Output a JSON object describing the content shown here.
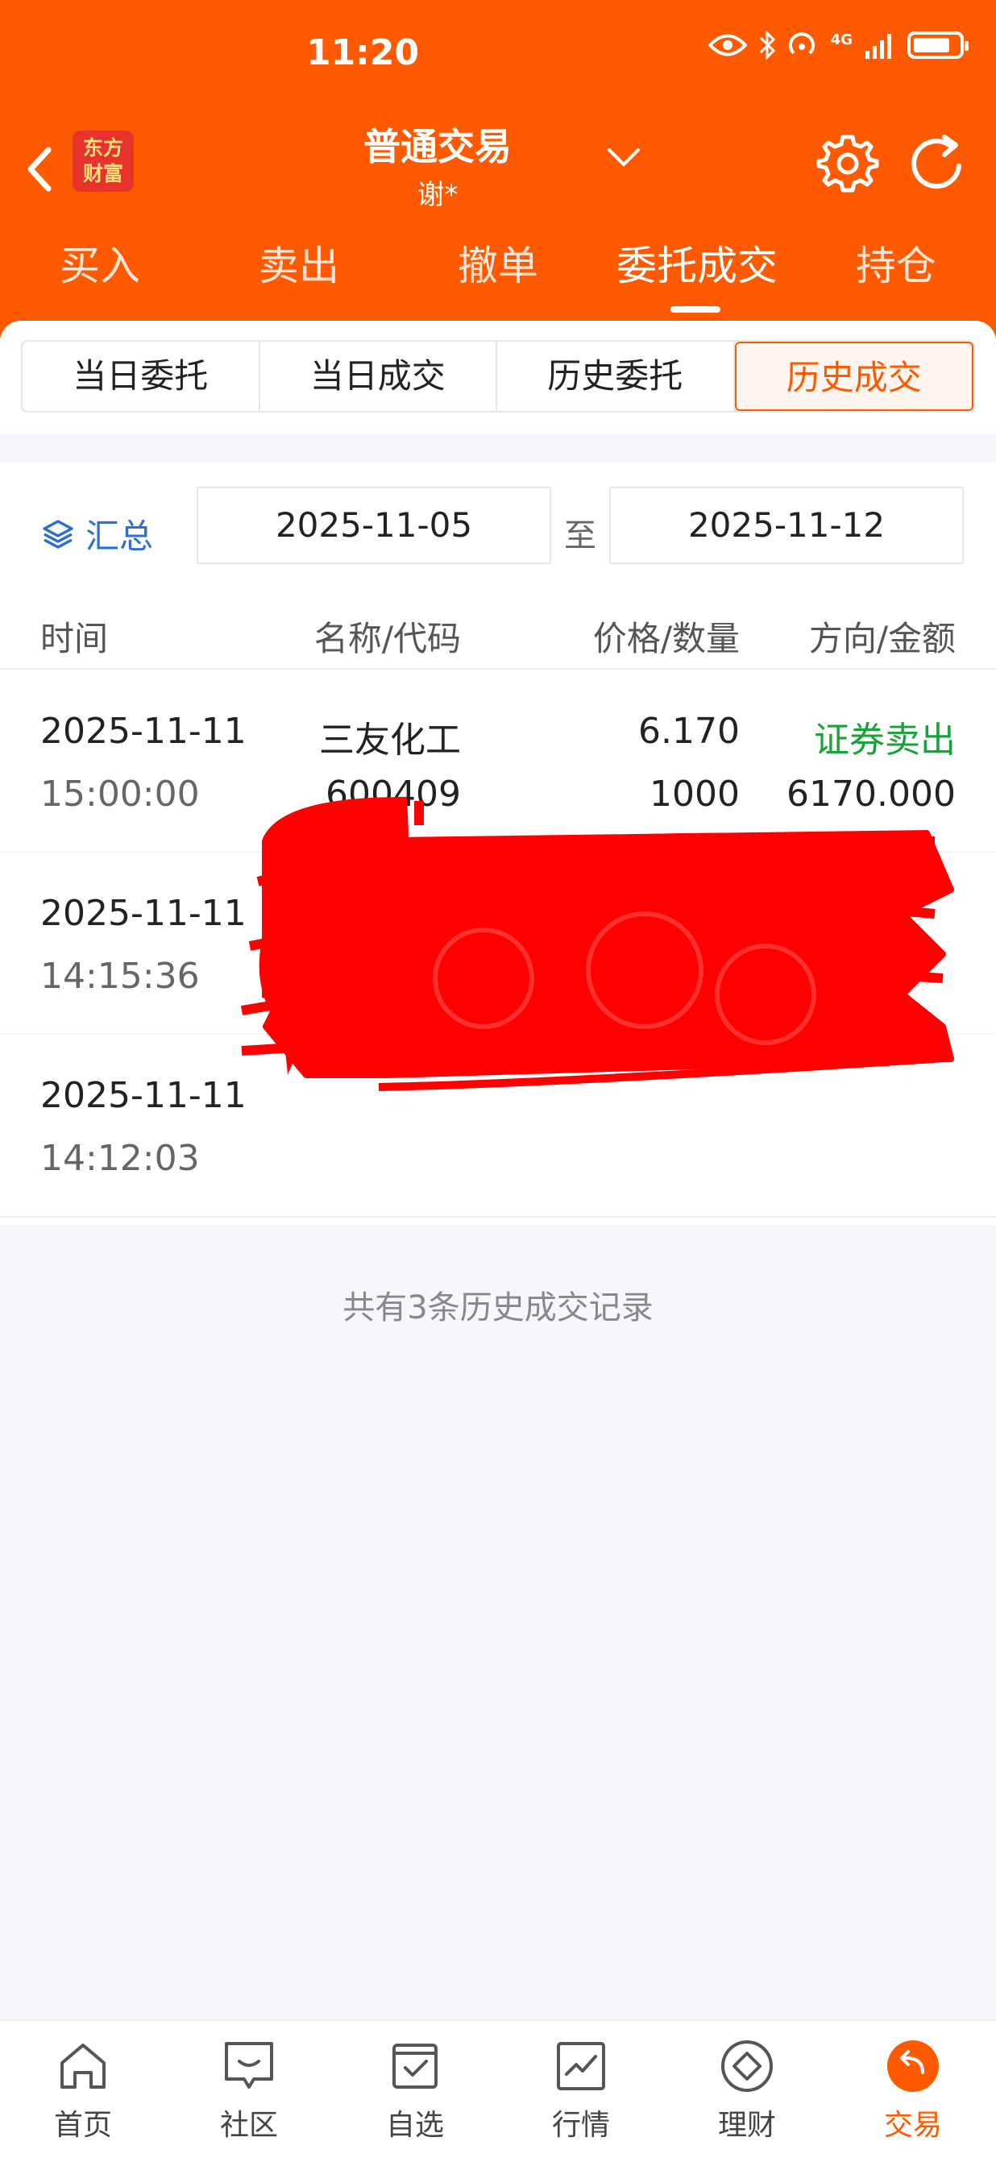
{
  "status_bar": {
    "time": "11:20",
    "network": "4G"
  },
  "header": {
    "logo_text": "东方财富",
    "title": "普通交易",
    "account": "谢*"
  },
  "main_tabs": [
    {
      "label": "买入"
    },
    {
      "label": "卖出"
    },
    {
      "label": "撤单"
    },
    {
      "label": "委托成交",
      "active": true
    },
    {
      "label": "持仓"
    }
  ],
  "sub_tabs": [
    {
      "label": "当日委托"
    },
    {
      "label": "当日成交"
    },
    {
      "label": "历史委托"
    },
    {
      "label": "历史成交",
      "active": true
    }
  ],
  "filter": {
    "summary_label": "汇总",
    "start_date": "2025-11-05",
    "to_label": "至",
    "end_date": "2025-11-12"
  },
  "table": {
    "headers": [
      "时间",
      "名称/代码",
      "价格/数量",
      "方向/金额"
    ],
    "rows": [
      {
        "date": "2025-11-11",
        "time": "15:00:00",
        "name": "三友化工",
        "code": "600409",
        "price": "6.170",
        "quantity": "1000",
        "direction": "证券卖出",
        "amount": "6170.000"
      },
      {
        "date": "2025-11-11",
        "time": "14:15:36",
        "name": "",
        "code": "",
        "price": "",
        "quantity": "",
        "direction": "",
        "amount": ""
      },
      {
        "date": "2025-11-11",
        "time": "14:12:03",
        "name": "",
        "code": "",
        "price": "",
        "quantity": "",
        "direction": "",
        "amount": ""
      }
    ]
  },
  "footer_text": "共有3条历史成交记录",
  "bottom_nav": [
    {
      "label": "首页",
      "icon": "home-icon"
    },
    {
      "label": "社区",
      "icon": "chat-icon"
    },
    {
      "label": "自选",
      "icon": "watchlist-icon"
    },
    {
      "label": "行情",
      "icon": "chart-icon"
    },
    {
      "label": "理财",
      "icon": "diamond-icon"
    },
    {
      "label": "交易",
      "icon": "trade-icon",
      "active": true
    }
  ],
  "colors": {
    "brand": "#ff5a00",
    "sell_green": "#1aa23a",
    "link_blue": "#2d6fd3",
    "redaction": "#ff0000"
  }
}
